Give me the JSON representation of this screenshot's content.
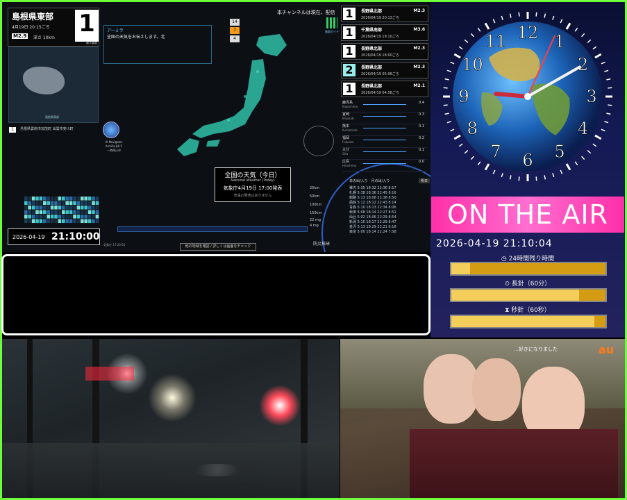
{
  "earthquake": {
    "region": "島根県東部",
    "time": "4月19日 20:15ごろ",
    "magnitude": "M2.9",
    "depth": "深さ 10km",
    "intensity": "1",
    "intensity_caption": "最大震度",
    "inset_caption": "島根県東部",
    "observation_badge": "1",
    "observation_text": "島根県雲南市加茂町 出雲市斐川町"
  },
  "navigator": {
    "title": "AI Navigator",
    "subtitle": "Armilla β0.5",
    "status": "一時停止中"
  },
  "weather_note": {
    "title": "アーミラ",
    "text": "全国の天気をお伝えします。北"
  },
  "channel_message": "本チャンネルは現在、配信",
  "level_stack": [
    "14",
    "7",
    "4"
  ],
  "qr_label": "画面ガイド",
  "weather_box": {
    "title": "全国の天気（今日）",
    "subtitle": "National Weather (Today)",
    "issued": "気象庁4月19日 17:00発表",
    "note": "気温の発表はありません"
  },
  "clock_box": {
    "date": "2026-04-19",
    "time": "21:10:00"
  },
  "check_button": "他の地域を確認 / 詳しくは画面をチェック",
  "footer_time": "気象庁 17:20:55",
  "scale_labels": [
    "25km",
    "50km",
    "100km",
    "150km",
    "22 mg",
    "4 mg"
  ],
  "disaster_logo": "防災科研",
  "eq_list": [
    {
      "n": "1",
      "location": "長野県北部",
      "time": "2026/04/19 20:13ごろ",
      "mag": "M2.3",
      "style": "white"
    },
    {
      "n": "1",
      "location": "千葉県南部",
      "time": "2026/04/19 19:10ごろ",
      "mag": "M3.6",
      "style": "white"
    },
    {
      "n": "1",
      "location": "長野県北部",
      "time": "2026/04/19 18:00ごろ",
      "mag": "M2.3",
      "style": "white"
    },
    {
      "n": "2",
      "location": "長野県北部",
      "time": "2026/04/19 05:08ごろ",
      "mag": "M2.3",
      "style": "teal"
    },
    {
      "n": "1",
      "location": "長野県北部",
      "time": "2026/04/19 04:58ごろ",
      "mag": "M2.1",
      "style": "white"
    }
  ],
  "rain_stations": [
    {
      "name": "鹿児島",
      "roman": "Kagoshima",
      "value": "0.4"
    },
    {
      "name": "宮崎",
      "roman": "Miyazaki",
      "value": "0.3"
    },
    {
      "name": "熊本",
      "roman": "Kumamoto",
      "value": "0.1"
    },
    {
      "name": "福岡",
      "roman": "Fukuoka",
      "value": "0.2"
    },
    {
      "name": "大分",
      "roman": "Oita",
      "value": "0.1"
    },
    {
      "name": "広島",
      "roman": "Hiroshima",
      "value": "0.0"
    }
  ],
  "sun_table": {
    "header": "日の出/入り　月の出/入り",
    "tab": "明日",
    "rows": [
      "稚内 5:35 18:32 22:36 8:17",
      "札幌 5:38 18:36 22:45 8:16",
      "釧路 5:13 18:08 22:38 8:50",
      "函館 5:12 18:12 22:43 8:14",
      "青森 5:10 18:13 22:34 8:06",
      "秋田 5:08 18:14 22:27 8:51",
      "仙台 5:02 18:06 22:29 8:54",
      "新潟 5:10 18:17 22:29 8:47",
      "金沢 5:13 18:29 22:21 8:18",
      "東京 5:00 18:14 22:24 7:58"
    ]
  },
  "clock": {
    "numerals": [
      "12",
      "1",
      "2",
      "3",
      "4",
      "5",
      "6",
      "7",
      "8",
      "9",
      "10",
      "11"
    ],
    "hour": 9,
    "minute": 10,
    "second": 4
  },
  "on_air": {
    "label": "ON THE AIR",
    "datetime": "2026-04-19 21:10:04",
    "bars": [
      {
        "label": "24時間残り時間",
        "progress": 0.12
      },
      {
        "label": "長針（60分）",
        "progress": 0.83
      },
      {
        "label": "秒針（60秒）",
        "progress": 0.93
      }
    ]
  },
  "school_cam": {
    "caption": "…好きになりました",
    "brand": "au"
  },
  "colors": {
    "frame": "#6cff3a",
    "onair": "#ff2fa8",
    "bar": "#d39c12",
    "bar_fill": "#f4ce5a"
  }
}
